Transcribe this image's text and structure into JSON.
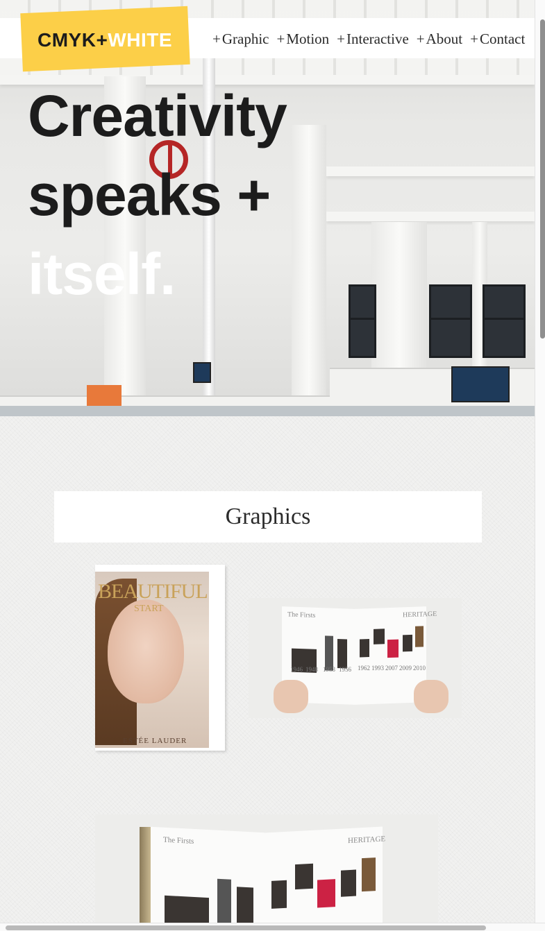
{
  "brand": {
    "logo_part1": "CMYK+",
    "logo_part2": "WHITE",
    "logo_bg": "#fccf48"
  },
  "nav": [
    {
      "plus": "+",
      "label": "Graphic"
    },
    {
      "plus": "+",
      "label": "Motion"
    },
    {
      "plus": "+",
      "label": "Interactive"
    },
    {
      "plus": "+",
      "label": "About"
    },
    {
      "plus": "+",
      "label": "Contact"
    }
  ],
  "hero": {
    "line1": "Creativity",
    "line2": "speaks +",
    "line3": "itself."
  },
  "section": {
    "title": "Graphics"
  },
  "cover": {
    "title": "BEAUTIFUL",
    "subtitle": "START",
    "brand": "ESTÉE LAUDER"
  },
  "spread": {
    "left_head": "The Firsts",
    "right_head": "HERITAGE",
    "years": [
      "1946",
      "1948",
      "1953",
      "1956",
      "1962",
      "1993",
      "2007",
      "2009",
      "2010"
    ]
  },
  "spread_big": {
    "left_head": "The Firsts",
    "right_head": "HERITAGE"
  }
}
